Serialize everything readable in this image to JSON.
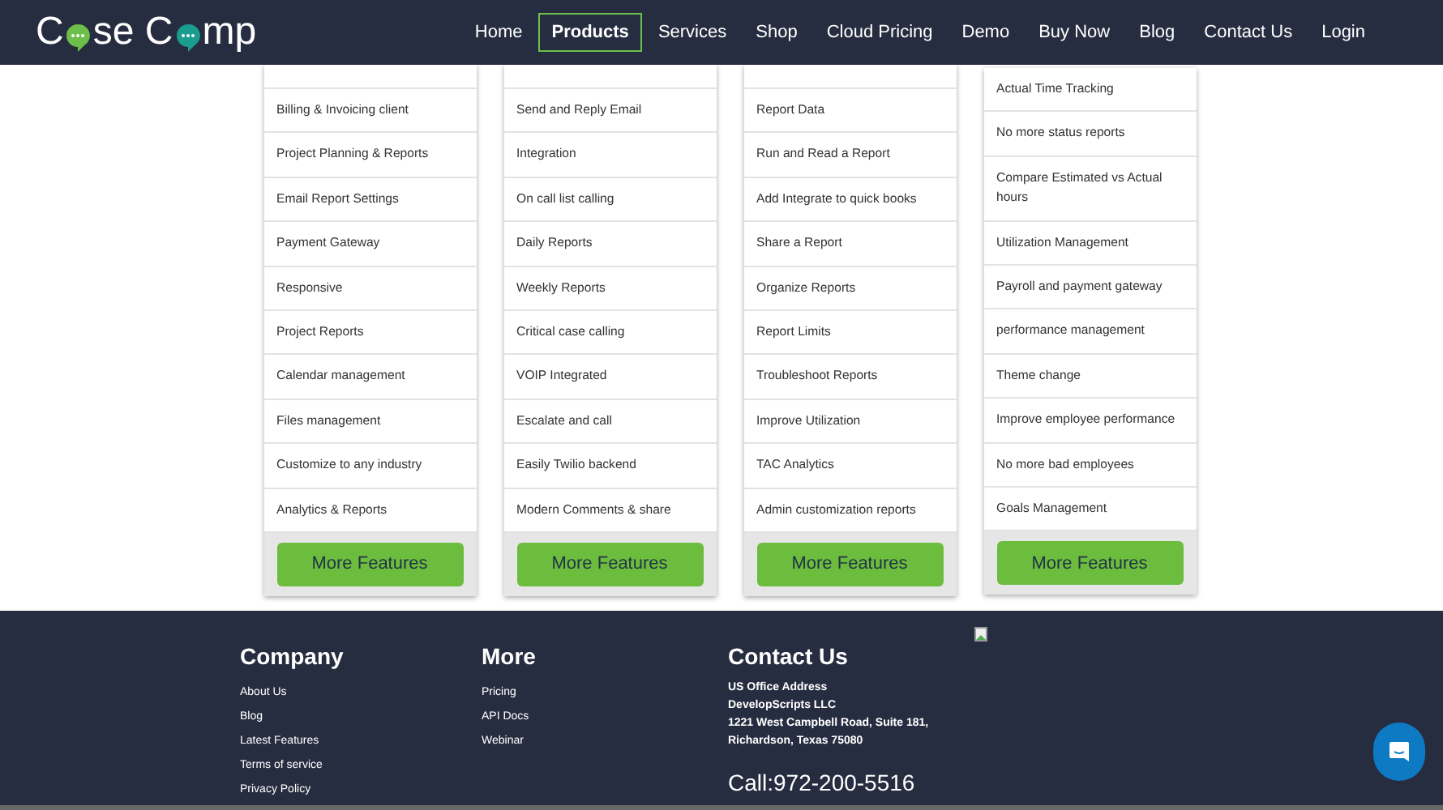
{
  "logo": {
    "parts": [
      "C",
      "se C",
      "mp"
    ]
  },
  "nav": [
    {
      "label": "Home",
      "selected": false
    },
    {
      "label": "Products",
      "selected": true
    },
    {
      "label": "Services",
      "selected": false
    },
    {
      "label": "Shop",
      "selected": false
    },
    {
      "label": "Cloud Pricing",
      "selected": false
    },
    {
      "label": "Demo",
      "selected": false
    },
    {
      "label": "Buy Now",
      "selected": false
    },
    {
      "label": "Blog",
      "selected": false
    },
    {
      "label": "Contact Us",
      "selected": false
    },
    {
      "label": "Login",
      "selected": false
    }
  ],
  "plans": [
    {
      "cut_top": true,
      "features": [
        "Billing & Invoicing client",
        "Project Planning & Reports",
        "Email Report Settings",
        "Payment Gateway",
        "Responsive",
        "Project Reports",
        "Calendar management",
        "Files management",
        "Customize to any industry",
        "Analytics & Reports"
      ],
      "button": "More Features"
    },
    {
      "cut_top": true,
      "features": [
        "Send and Reply Email",
        "Integration",
        "On call list calling",
        "Daily Reports",
        "Weekly Reports",
        "Critical case calling",
        "VOIP Integrated",
        "Escalate and call",
        "Easily Twilio backend",
        "Modern Comments & share"
      ],
      "button": "More Features"
    },
    {
      "cut_top": true,
      "features": [
        "Report Data",
        "Run and Read a Report",
        "Add Integrate to quick books",
        "Share a Report",
        "Organize Reports",
        "Report Limits",
        "Troubleshoot Reports",
        "Improve Utilization",
        "TAC Analytics",
        "Admin customization reports"
      ],
      "button": "More Features"
    },
    {
      "cut_top": false,
      "features": [
        "Actual Time Tracking",
        "No more status reports",
        "Compare Estimated vs Actual hours",
        "Utilization Management",
        "Payroll and payment gateway",
        "performance management",
        "Theme change",
        "Improve employee performance",
        "No more bad employees",
        "Goals Management"
      ],
      "button": "More Features"
    }
  ],
  "footer": {
    "company": {
      "title": "Company",
      "links": [
        "About Us",
        "Blog",
        "Latest Features",
        "Terms of service",
        "Privacy Policy"
      ]
    },
    "more": {
      "title": "More",
      "links": [
        "Pricing",
        "API Docs",
        "Webinar"
      ]
    },
    "contact": {
      "title": "Contact Us",
      "address": [
        "US Office Address",
        "DevelopScripts LLC",
        "1221 West Campbell Road, Suite 181,",
        "Richardson, Texas 75080"
      ],
      "phone": "Call:972-200-5516"
    }
  }
}
